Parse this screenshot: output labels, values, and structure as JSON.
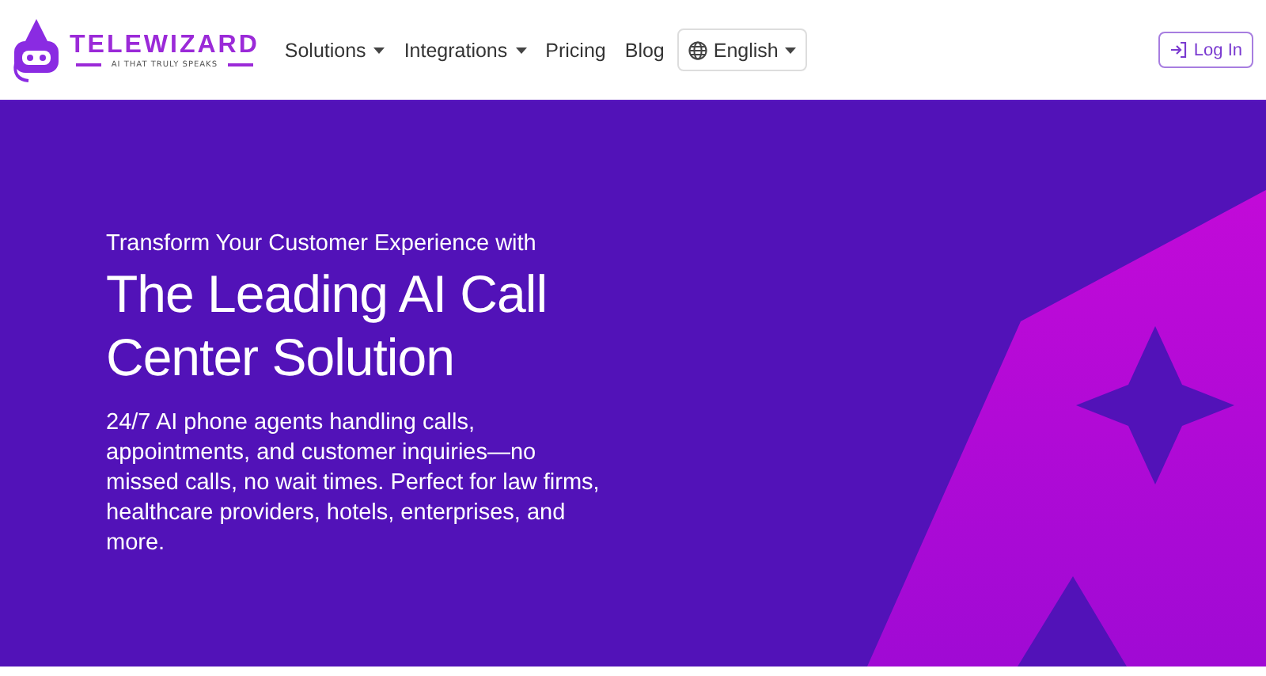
{
  "logo": {
    "name": "TELEWIZARD",
    "tagline": "AI THAT TRULY SPEAKS"
  },
  "nav": [
    {
      "label": "Solutions",
      "dropdown": true
    },
    {
      "label": "Integrations",
      "dropdown": true
    },
    {
      "label": "Pricing",
      "dropdown": false
    },
    {
      "label": "Blog",
      "dropdown": false
    }
  ],
  "language": {
    "label": "English"
  },
  "login": {
    "label": "Log In"
  },
  "hero": {
    "eyebrow": "Transform Your Customer Experience with",
    "title": "The Leading AI Call Center Solution",
    "description": "24/7 AI phone agents handling calls, appointments, and customer inquiries—no missed calls, no wait times. Perfect for law firms, healthcare providers, hotels, enterprises, and more."
  }
}
